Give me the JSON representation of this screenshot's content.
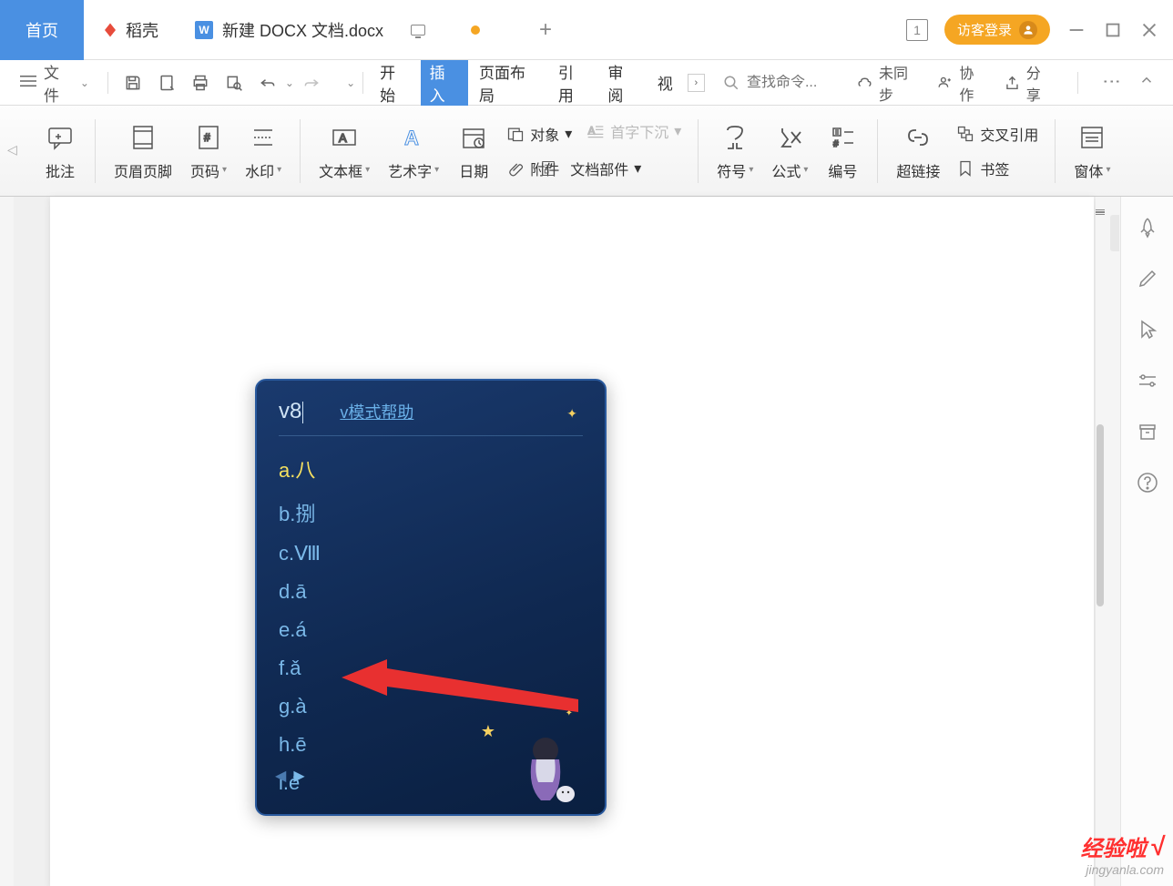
{
  "titleBar": {
    "homeTab": "首页",
    "daoKeTab": "稻壳",
    "docTab": "新建 DOCX 文档.docx",
    "windowNum": "1",
    "loginBtn": "访客登录"
  },
  "menuBar": {
    "file": "文件",
    "tabs": {
      "start": "开始",
      "insert": "插入",
      "layout": "页面布局",
      "reference": "引用",
      "review": "审阅",
      "view": "视"
    },
    "searchPlaceholder": "查找命令...",
    "right": {
      "unsync": "未同步",
      "collab": "协作",
      "share": "分享"
    }
  },
  "ribbon": {
    "comment": "批注",
    "headerFooter": "页眉页脚",
    "pageNum": "页码",
    "watermark": "水印",
    "textbox": "文本框",
    "wordart": "艺术字",
    "date": "日期",
    "object": "对象",
    "attachment": "附件",
    "dropcap": "首字下沉",
    "docParts": "文档部件",
    "symbol": "符号",
    "formula": "公式",
    "numbering": "编号",
    "hyperlink": "超链接",
    "crossref": "交叉引用",
    "bookmark": "书签",
    "pane": "窗体"
  },
  "ime": {
    "input": "v8",
    "help": "v模式帮助",
    "items": [
      "a.八",
      "b.捌",
      "c.Ⅷ",
      "d.ā",
      "e.á",
      "f.ǎ",
      "g.à",
      "h.ē",
      "i.é"
    ]
  },
  "watermark": {
    "main": "经验啦",
    "sub": "jingyanla.com"
  }
}
